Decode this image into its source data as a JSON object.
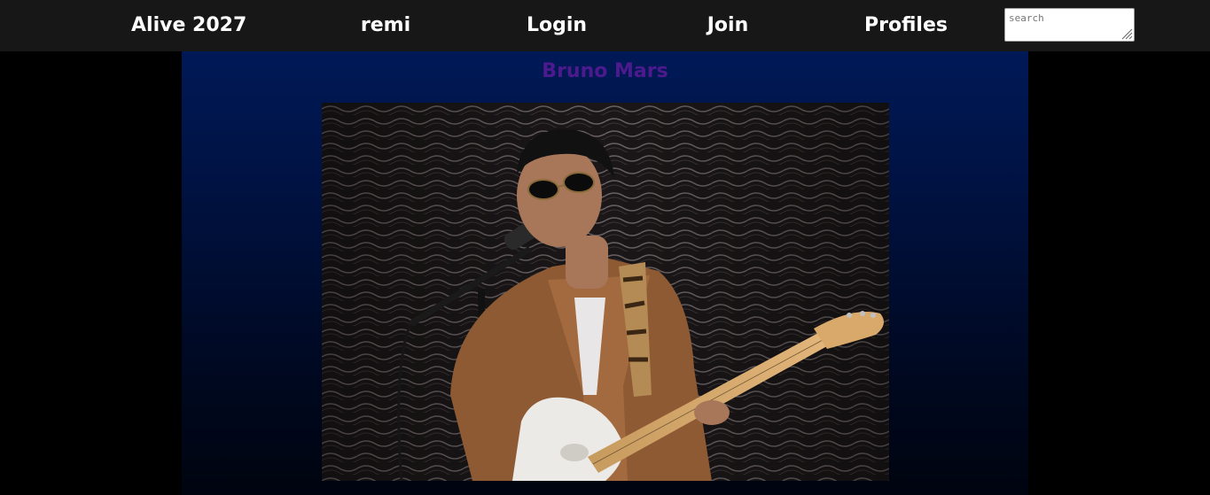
{
  "nav": {
    "site_title": "Alive 2027",
    "user": "remi",
    "login": "Login",
    "join": "Join",
    "profiles": "Profiles"
  },
  "search": {
    "placeholder": "search"
  },
  "artist": {
    "name": "Bruno Mars"
  },
  "colors": {
    "topbar": "#171717",
    "nav_text": "#ffffff",
    "panel_top": "#001957",
    "panel_bottom": "#00040f",
    "artist_name": "#4d1a8e"
  }
}
